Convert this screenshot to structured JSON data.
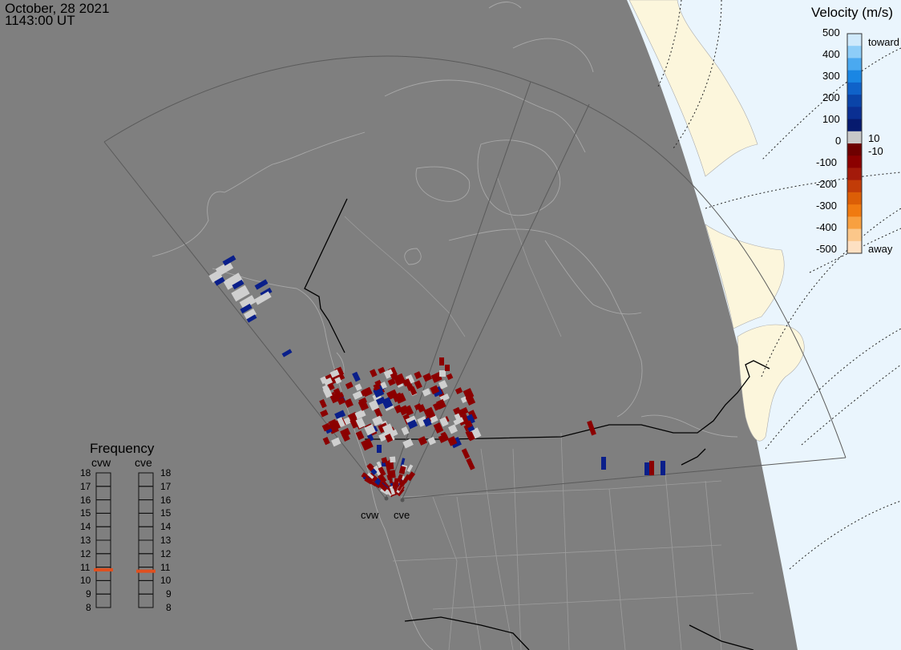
{
  "header": {
    "date": "October, 28 2021",
    "time": "1143:00 UT"
  },
  "colors": {
    "night": "#7f7f7f",
    "ocean": "#eaf5fd",
    "land": "#fcf6dc",
    "toward": "#0a1f8a",
    "away": "#8b0000",
    "ground_scatter": "#cfcfcf",
    "frequency_marker": "#e0501f"
  },
  "velocity_scale": {
    "title": "Velocity (m/s)",
    "ticks": [
      "500",
      "400",
      "300",
      "200",
      "100",
      "0",
      "-100",
      "-200",
      "-300",
      "-400",
      "-500"
    ],
    "zero_labels": [
      "10",
      "-10"
    ],
    "toward_label": "toward",
    "away_label": "away"
  },
  "radars": [
    {
      "id": "cvw",
      "label": "cvw",
      "frequency_mhz": 10.8
    },
    {
      "id": "cve",
      "label": "cve",
      "frequency_mhz": 10.7
    }
  ],
  "frequency_panel": {
    "title": "Frequency",
    "scale": [
      "18",
      "17",
      "16",
      "15",
      "14",
      "13",
      "12",
      "11",
      "10",
      "9",
      "8"
    ]
  }
}
